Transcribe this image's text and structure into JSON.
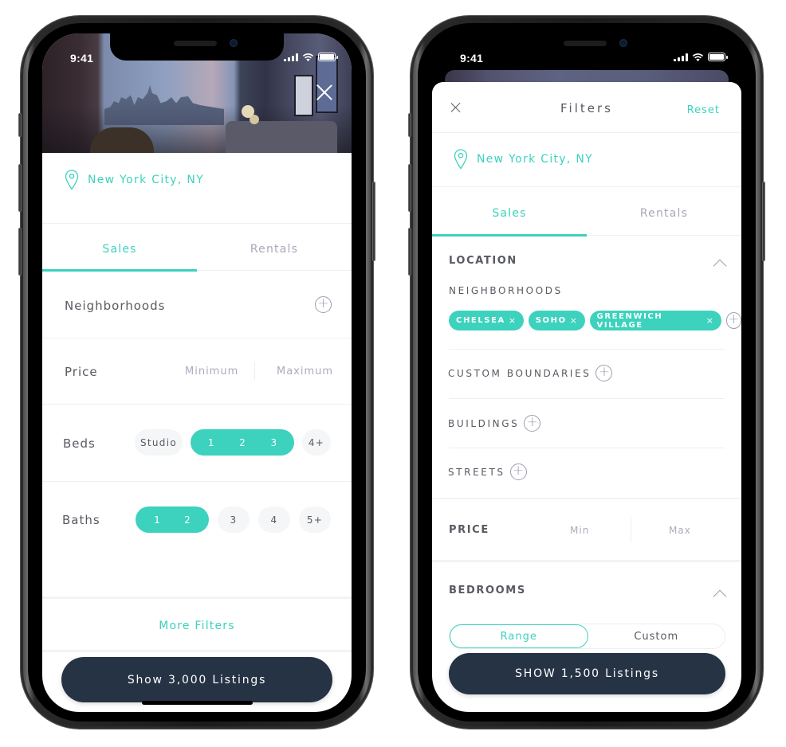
{
  "status_bar": {
    "time": "9:41"
  },
  "left_screen": {
    "location": "New York City, NY",
    "tabs": [
      {
        "label": "Sales",
        "active": true
      },
      {
        "label": "Rentals",
        "active": false
      }
    ],
    "neighborhoods_label": "Neighborhoods",
    "price": {
      "label": "Price",
      "min_placeholder": "Minimum",
      "max_placeholder": "Maximum"
    },
    "beds": {
      "label": "Beds",
      "options": [
        "Studio",
        "1",
        "2",
        "3",
        "4+"
      ],
      "selected": [
        "1",
        "2",
        "3"
      ],
      "studio": "Studio",
      "opt1": "1",
      "opt2": "2",
      "opt3": "3",
      "opt4": "4+"
    },
    "baths": {
      "label": "Baths",
      "options": [
        "1",
        "2",
        "3",
        "4",
        "5+"
      ],
      "selected": [
        "1",
        "2"
      ],
      "opt1": "1",
      "opt2": "2",
      "opt3": "3",
      "opt4": "4",
      "opt5": "5+"
    },
    "more_filters": "More Filters",
    "cta": "Show 3,000 Listings"
  },
  "right_screen": {
    "title": "Filters",
    "reset": "Reset",
    "location": "New York City, NY",
    "tabs": [
      {
        "label": "Sales",
        "active": true
      },
      {
        "label": "Rentals",
        "active": false
      }
    ],
    "location_section": {
      "heading": "LOCATION",
      "neighborhoods_label": "NEIGHBORHOODS",
      "chips": [
        "CHELSEA",
        "SOHO",
        "GREENWICH VILLAGE"
      ],
      "custom_boundaries": "CUSTOM BOUNDARIES",
      "buildings": "BUILDINGS",
      "streets": "STREETS"
    },
    "price": {
      "heading": "PRICE",
      "min_placeholder": "Min",
      "max_placeholder": "Max"
    },
    "bedrooms": {
      "heading": "BEDROOMS",
      "modes": [
        "Range",
        "Custom"
      ],
      "selected_mode": "Range"
    },
    "cta": "SHOW 1,500 Listings"
  },
  "icons": {
    "remove_chip": "×",
    "add": "+"
  },
  "colors": {
    "accent": "#3cd2bd",
    "cta_bg": "#263345",
    "text": "#575a60",
    "muted": "#a9adbc"
  }
}
